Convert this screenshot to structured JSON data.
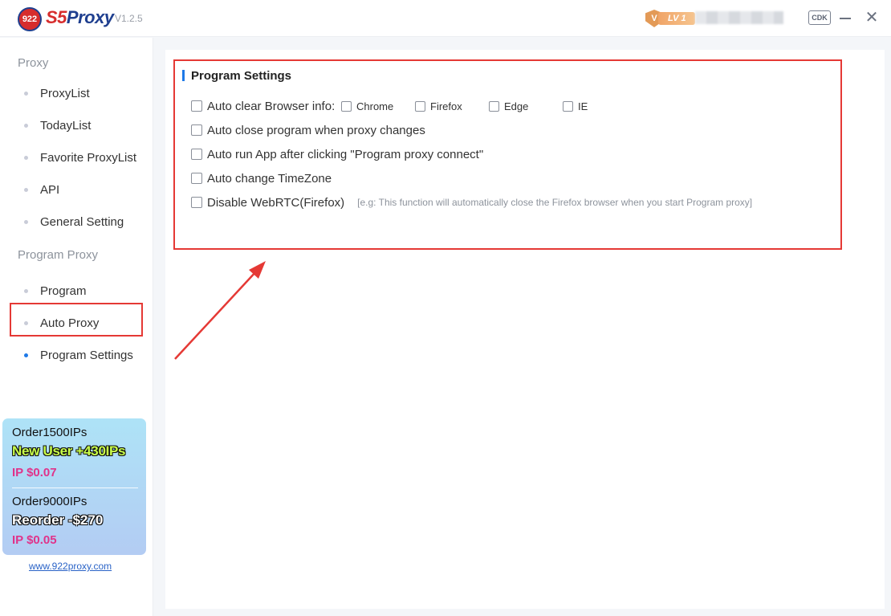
{
  "app": {
    "logo_badge": "922",
    "logo_name_part1": "S5",
    "logo_name_part2": "Proxy",
    "version": "V1.2.5",
    "level": "LV 1",
    "cdk_label": "CDK",
    "close_glyph": "✕"
  },
  "sidebar": {
    "sections": [
      {
        "title": "Proxy",
        "items": [
          "ProxyList",
          "TodayList",
          "Favorite ProxyList",
          "API",
          "General Setting"
        ]
      },
      {
        "title": "Program Proxy",
        "items": [
          "Program",
          "Auto Proxy",
          "Program Settings"
        ]
      }
    ],
    "active_item": "Program Settings"
  },
  "promo": {
    "offer1_title": "Order1500IPs",
    "offer1_bonus": "New User +430IPs",
    "offer1_price": "IP $0.07",
    "offer2_title": "Order9000IPs",
    "offer2_bonus": "Reorder -$270",
    "offer2_price": "IP $0.05",
    "link": "www.922proxy.com"
  },
  "panel": {
    "title": "Program Settings",
    "auto_clear_label": "Auto clear Browser info:",
    "browsers": [
      "Chrome",
      "Firefox",
      "Edge",
      "IE"
    ],
    "options": [
      "Auto close program when proxy changes",
      "Auto run App after clicking \"Program proxy connect\"",
      "Auto change TimeZone",
      "Disable WebRTC(Firefox)"
    ],
    "webrtc_note": "[e.g: This function will automatically close the Firefox browser when you start Program proxy]"
  },
  "colors": {
    "accent": "#1e79e7",
    "highlight": "#e53935",
    "brand_red": "#d72d2d",
    "brand_blue": "#1f3f8f"
  }
}
